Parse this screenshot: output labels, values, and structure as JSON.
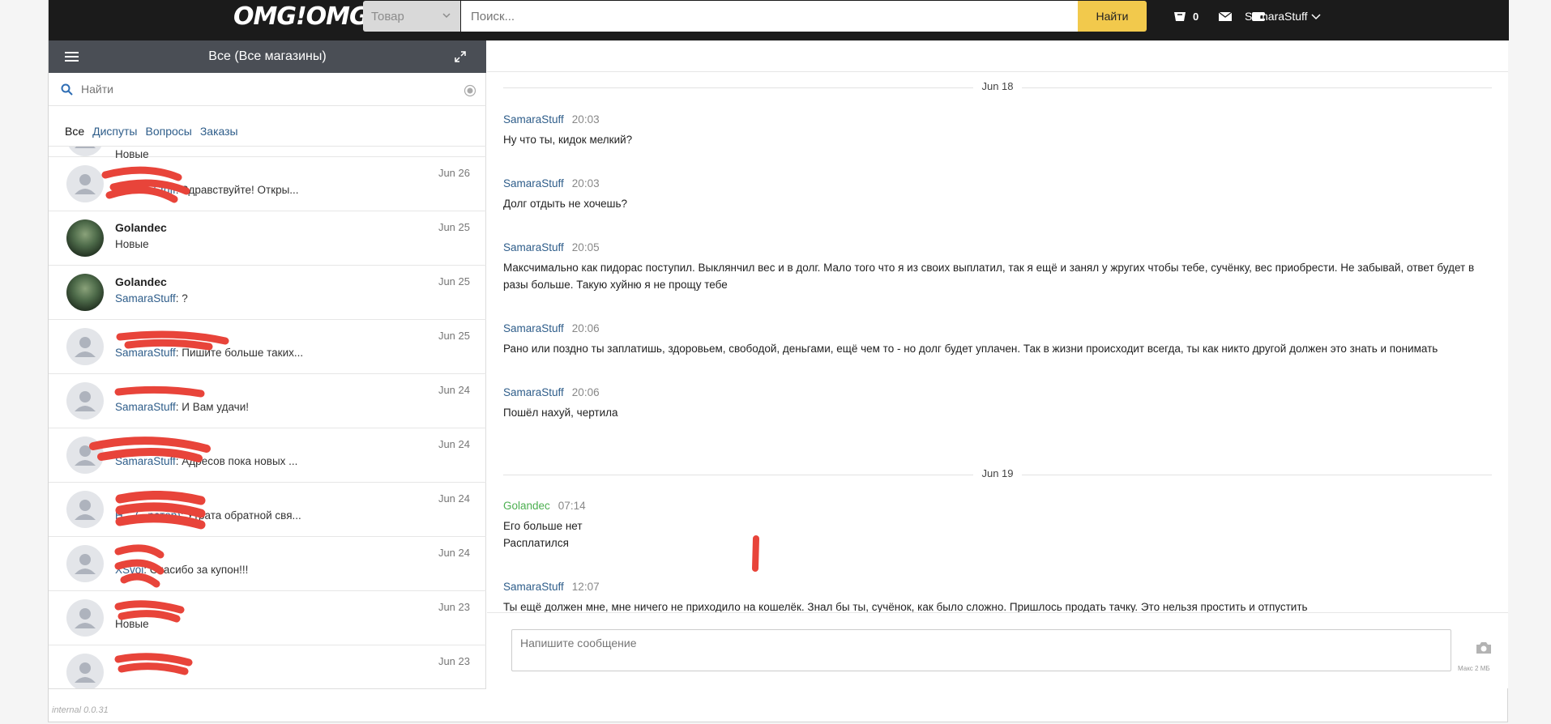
{
  "topbar": {
    "logo": "OMG!OMG!",
    "category_select": "Товар",
    "search_placeholder": "Поиск...",
    "search_button": "Найти",
    "cart_count": "0",
    "username": "SamaraStuff"
  },
  "left_panel": {
    "title": "Все (Все магазины)",
    "find_placeholder": "Найти",
    "tabs": [
      "Все",
      "Диспуты",
      "Вопросы",
      "Заказы"
    ],
    "partial_top_preview": "Новые",
    "conversations": [
      {
        "name": "",
        "date": "Jun 26",
        "who": "SamaraStuff",
        "text": ": Здравствуйте! Откры...",
        "avatar": "default"
      },
      {
        "name": "Golandec",
        "date": "Jun 25",
        "who": "",
        "text": "Новые",
        "avatar": "photo"
      },
      {
        "name": "Golandec",
        "date": "Jun 25",
        "who": "SamaraStuff",
        "text": ": ?",
        "avatar": "photo"
      },
      {
        "name": "",
        "date": "Jun 25",
        "who": "SamaraStuff",
        "text": ": Пишите больше таких...",
        "avatar": "default"
      },
      {
        "name": "",
        "date": "Jun 24",
        "who": "SamaraStuff",
        "text": ": И Вам удачи!",
        "avatar": "default"
      },
      {
        "name": "",
        "date": "Jun 24",
        "who": "SamaraStuff",
        "text": ": Адресов пока новых ...",
        "avatar": "default"
      },
      {
        "name": "",
        "date": "Jun 24",
        "who": "Н... (...ратор)",
        "text": ": Утрата обратной свя...",
        "avatar": "default"
      },
      {
        "name": "",
        "date": "Jun 24",
        "who": "XSvoi",
        "text": ": Спасибо за купон!!!",
        "avatar": "default"
      },
      {
        "name": "",
        "date": "Jun 23",
        "who": "",
        "text": "Новые",
        "avatar": "default"
      },
      {
        "name": "",
        "date": "Jun 23",
        "who": "",
        "text": "",
        "avatar": "default"
      }
    ],
    "footer": "internal 0.0.31"
  },
  "chat": {
    "days": [
      "Jun 18",
      "Jun 19"
    ],
    "messages": [
      {
        "author": "SamaraStuff",
        "time": "20:03",
        "lines": [
          "Ну что ты, кидок мелкий?"
        ]
      },
      {
        "author": "SamaraStuff",
        "time": "20:03",
        "lines": [
          "Долг отдыть не хочешь?"
        ]
      },
      {
        "author": "SamaraStuff",
        "time": "20:05",
        "lines": [
          "Максчимально как пидорас поступил. Выклянчил вес и в долг. Мало того что я из своих выплатил, так я ещё и занял у жругих чтобы тебе, сучёнку, вес приобрести. Не забывай, ответ будет в разы больше. Такую хуйню я не прощу тебе"
        ]
      },
      {
        "author": "SamaraStuff",
        "time": "20:06",
        "lines": [
          "Рано или поздно ты заплатишь, здоровьем, свободой, деньгами, ещё чем то - но долг будет уплачен. Так в жизни происходит всегда, ты как никто другой должен это знать и понимать"
        ]
      },
      {
        "author": "SamaraStuff",
        "time": "20:06",
        "lines": [
          "Пошёл нахуй, чертила"
        ]
      },
      {
        "author": "Golandec",
        "time": "07:14",
        "lines": [
          "Его больше нет",
          "Расплатился"
        ]
      },
      {
        "author": "SamaraStuff",
        "time": "12:07",
        "lines": [
          "Ты ещё должен мне, мне ничего не приходило на кошелёк. Знал бы ты, сучёнок, как было сложно. Пришлось продать тачку. Это нельзя простить и отпустить"
        ]
      }
    ],
    "compose_placeholder": "Напишите сообщение",
    "max_size": "Макс 2 МБ"
  },
  "colors": {
    "accent": "#2e5d8a",
    "button": "#f2c94c",
    "header": "#1b1b1b",
    "panel_head": "#4a4e55",
    "green": "#4caf50"
  }
}
